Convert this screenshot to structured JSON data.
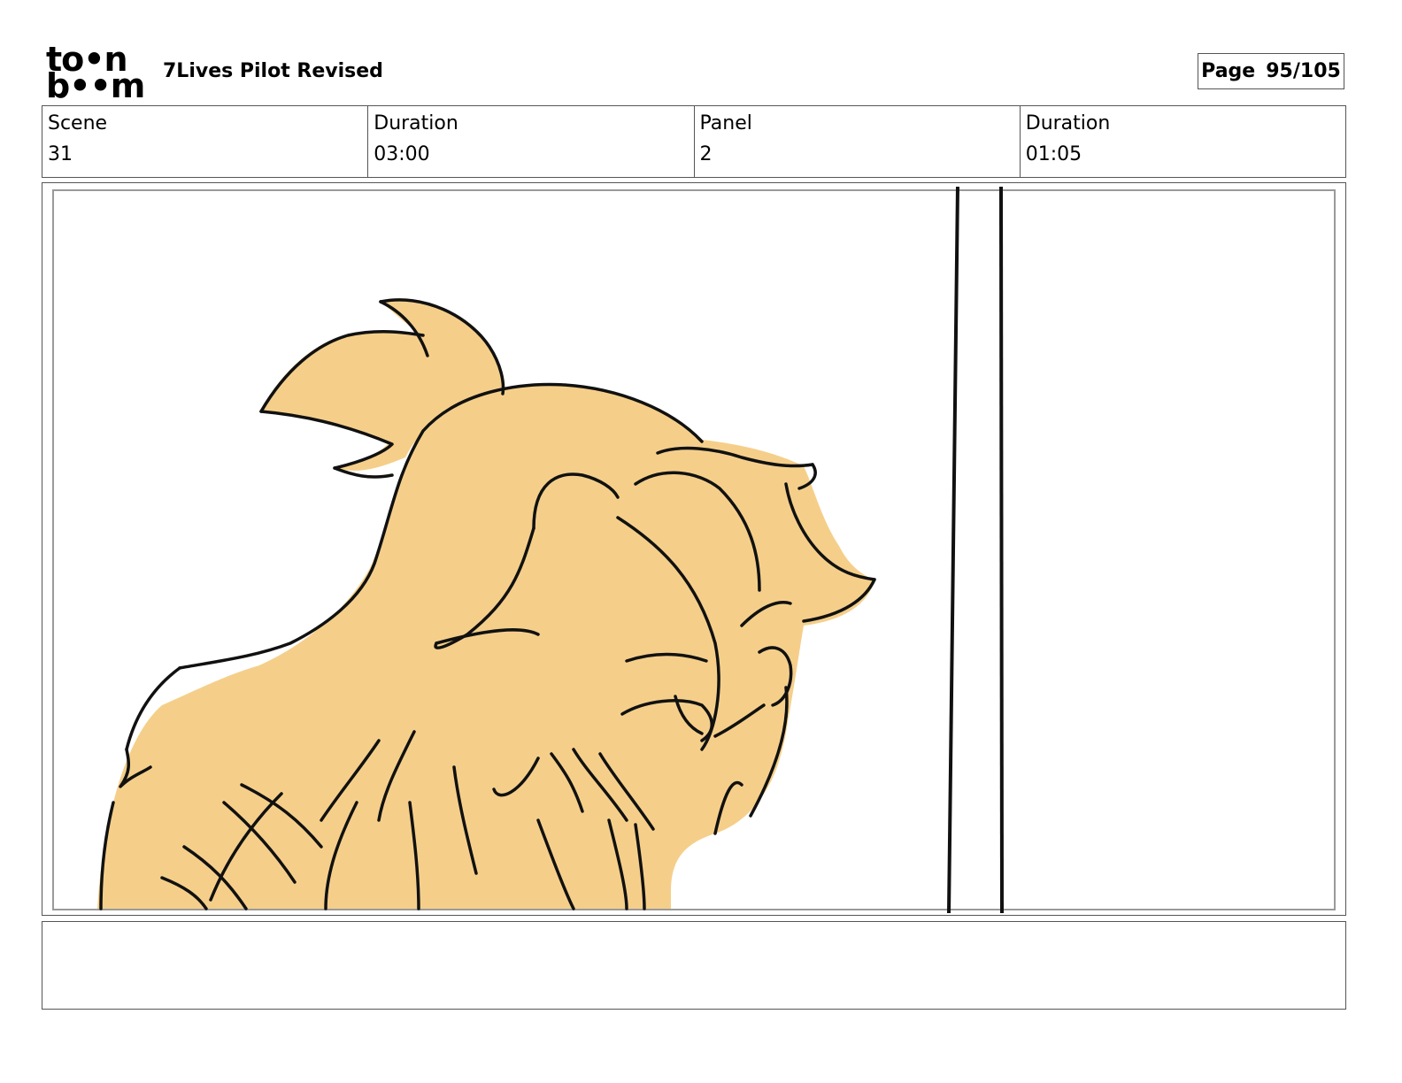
{
  "header": {
    "logo_top": "to•n",
    "logo_bottom": "b••m",
    "project_title": "7Lives Pilot Revised",
    "page_label": "Page",
    "page_number": "95/105"
  },
  "info": {
    "scene_label": "Scene",
    "scene_value": "31",
    "scene_duration_label": "Duration",
    "scene_duration_value": "03:00",
    "panel_label": "Panel",
    "panel_value": "2",
    "panel_duration_label": "Duration",
    "panel_duration_value": "01:05"
  },
  "panel": {
    "drawing": "character-sketch",
    "fill_color": "#F5CF8A",
    "line_color": "#111111"
  },
  "notes": {
    "text": ""
  }
}
